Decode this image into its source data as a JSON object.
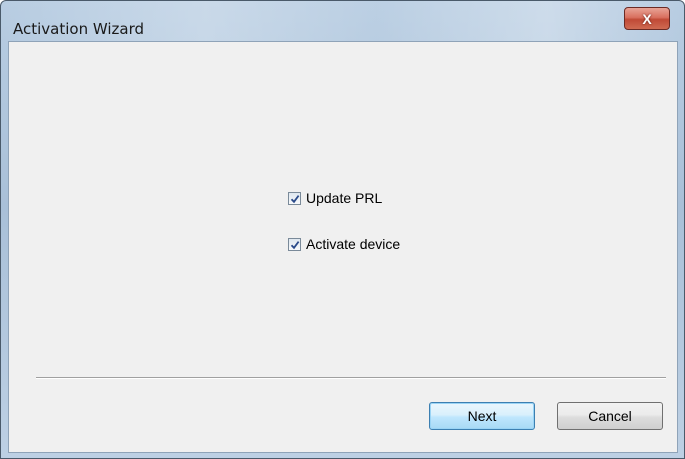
{
  "window": {
    "title": "Activation Wizard",
    "close_label": "X"
  },
  "options": [
    {
      "label": "Update PRL",
      "checked": true
    },
    {
      "label": "Activate device",
      "checked": true
    }
  ],
  "buttons": {
    "next_label": "Next",
    "cancel_label": "Cancel"
  },
  "colors": {
    "close_button": "#c04a36",
    "primary_button_border": "#3c7fb1",
    "client_background": "#f0f0f0"
  }
}
